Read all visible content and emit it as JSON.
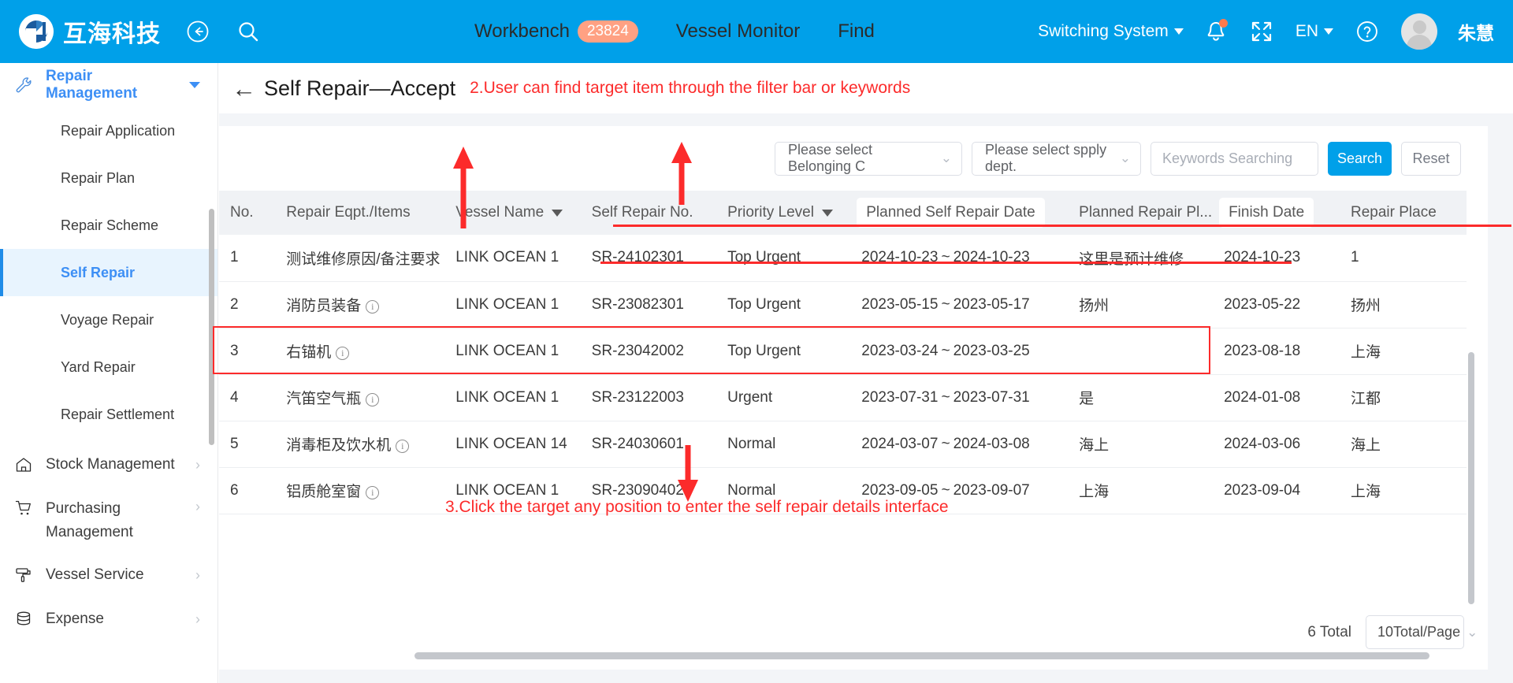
{
  "header": {
    "brand_name": "互海科技",
    "back_icon": "back-arrow-circle-icon",
    "search_icon": "search-icon",
    "nav": [
      {
        "label": "Workbench",
        "badge": "23824"
      },
      {
        "label": "Vessel Monitor",
        "badge": ""
      },
      {
        "label": "Find",
        "badge": ""
      }
    ],
    "switching_system": "Switching System",
    "language": "EN",
    "user_name": "朱慧",
    "bell_icon": "bell-icon",
    "fullscreen_icon": "fullscreen-icon",
    "help_icon": "question-circle-icon"
  },
  "sidebar": {
    "groups": [
      {
        "label": "Repair Management",
        "icon": "wrench-icon",
        "active": true,
        "expanded": true
      },
      {
        "label": "Stock Management",
        "icon": "home-icon",
        "active": false,
        "expanded": false
      },
      {
        "label": "Purchasing Management",
        "icon": "cart-icon",
        "active": false,
        "expanded": false
      },
      {
        "label": "Vessel Service",
        "icon": "paint-roller-icon",
        "active": false,
        "expanded": false
      },
      {
        "label": "Expense",
        "icon": "database-icon",
        "active": false,
        "expanded": false
      }
    ],
    "repair_items": [
      {
        "label": "Repair Application",
        "selected": false
      },
      {
        "label": "Repair Plan",
        "selected": false
      },
      {
        "label": "Repair Scheme",
        "selected": false
      },
      {
        "label": "Self Repair",
        "selected": true
      },
      {
        "label": "Voyage Repair",
        "selected": false
      },
      {
        "label": "Yard Repair",
        "selected": false
      },
      {
        "label": "Repair Settlement",
        "selected": false
      }
    ]
  },
  "page": {
    "title": "Self Repair—Accept",
    "back_icon": "left-arrow-icon"
  },
  "annotations": [
    {
      "id": "annot-2",
      "text": "2.User can find target item through the filter bar or keywords"
    },
    {
      "id": "annot-3",
      "text": "3.Click the target any position to enter the self repair details interface"
    }
  ],
  "filter_bar": {
    "belonging_company": "Please select Belonging C",
    "supply_dept": "Please select spply dept.",
    "keywords_placeholder": "Keywords Searching",
    "keywords_value": "",
    "search_label": "Search",
    "reset_label": "Reset"
  },
  "table": {
    "columns": [
      {
        "label": "No.",
        "sortable": false,
        "pill": false
      },
      {
        "label": "Repair Eqpt./Items",
        "sortable": false,
        "pill": false
      },
      {
        "label": "Vessel Name",
        "sortable": true,
        "pill": false
      },
      {
        "label": "Self Repair No.",
        "sortable": false,
        "pill": false
      },
      {
        "label": "Priority Level",
        "sortable": true,
        "pill": false
      },
      {
        "label": "Planned Self Repair Date",
        "sortable": false,
        "pill": true
      },
      {
        "label": "Planned Repair Pl...",
        "sortable": false,
        "pill": false
      },
      {
        "label": "Finish Date",
        "sortable": false,
        "pill": true
      },
      {
        "label": "Repair Place",
        "sortable": false,
        "pill": false
      }
    ],
    "rows": [
      {
        "no": "1",
        "eqpt": "测试维修原因/备注要求",
        "has_info": false,
        "vessel": "LINK OCEAN 1",
        "self_repair_no": "SR-24102301",
        "priority": "Top Urgent",
        "plan_start": "2024-10-23",
        "plan_end": "2024-10-23",
        "planned_place": "这里是预计维修地点",
        "finish_date": "2024-10-23",
        "repair_place": "1",
        "highlighted": false
      },
      {
        "no": "2",
        "eqpt": "消防员装备",
        "has_info": true,
        "vessel": "LINK OCEAN 1",
        "self_repair_no": "SR-23082301",
        "priority": "Top Urgent",
        "plan_start": "2023-05-15",
        "plan_end": "2023-05-17",
        "planned_place": "扬州",
        "finish_date": "2023-05-22",
        "repair_place": "扬州",
        "highlighted": false
      },
      {
        "no": "3",
        "eqpt": "右锚机",
        "has_info": true,
        "vessel": "LINK OCEAN 1",
        "self_repair_no": "SR-23042002",
        "priority": "Top Urgent",
        "plan_start": "2023-03-24",
        "plan_end": "2023-03-25",
        "planned_place": "",
        "finish_date": "2023-08-18",
        "repair_place": "上海",
        "highlighted": true
      },
      {
        "no": "4",
        "eqpt": "汽笛空气瓶",
        "has_info": true,
        "vessel": "LINK OCEAN 1",
        "self_repair_no": "SR-23122003",
        "priority": "Urgent",
        "plan_start": "2023-07-31",
        "plan_end": "2023-07-31",
        "planned_place": "是",
        "finish_date": "2024-01-08",
        "repair_place": "江都",
        "highlighted": false
      },
      {
        "no": "5",
        "eqpt": "消毒柜及饮水机",
        "has_info": true,
        "vessel": "LINK OCEAN 14",
        "self_repair_no": "SR-24030601",
        "priority": "Normal",
        "plan_start": "2024-03-07",
        "plan_end": "2024-03-08",
        "planned_place": "海上",
        "finish_date": "2024-03-06",
        "repair_place": "海上",
        "highlighted": false
      },
      {
        "no": "6",
        "eqpt": "铝质舱室窗",
        "has_info": true,
        "vessel": "LINK OCEAN 1",
        "self_repair_no": "SR-23090402",
        "priority": "Normal",
        "plan_start": "2023-09-05",
        "plan_end": "2023-09-07",
        "planned_place": "上海",
        "finish_date": "2023-09-04",
        "repair_place": "上海",
        "highlighted": false
      }
    ],
    "date_separator": "~"
  },
  "pagination": {
    "total_label": "6 Total",
    "page_size": "10Total/Page"
  },
  "colors": {
    "header_blue": "#00a0e9",
    "accent_blue": "#3d8ff5",
    "annotation_red": "#fc2b2b",
    "badge_orange": "#ffa183"
  }
}
